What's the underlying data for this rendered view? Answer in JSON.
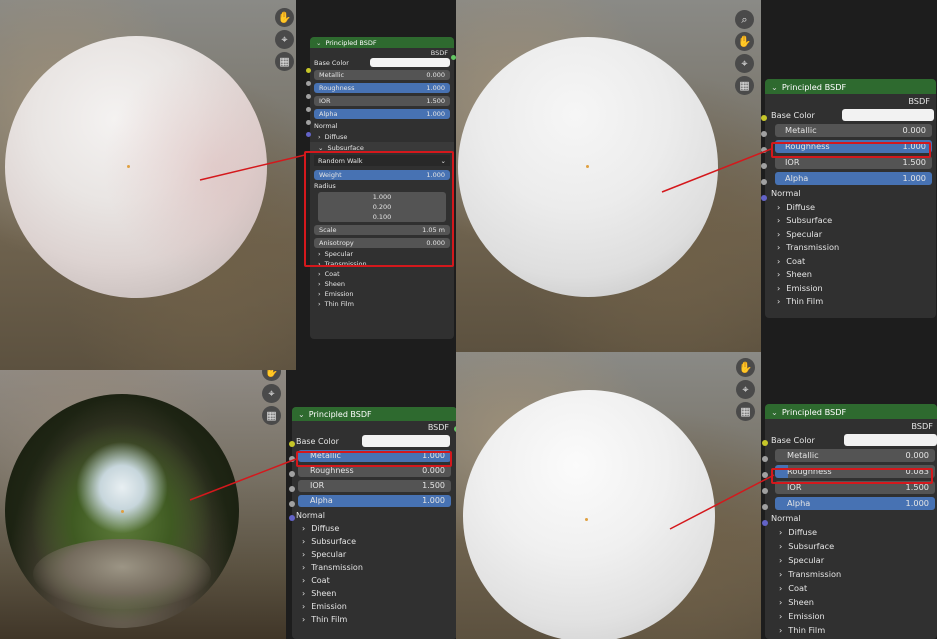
{
  "colors": {
    "header_green": "#2e6a2f",
    "field_grey": "#545454",
    "field_active_blue": "#4772b3",
    "panel_bg": "#303030",
    "highlight_red": "#d4181c",
    "socket_yellow": "#c7c729",
    "socket_grey": "#a1a1a1",
    "socket_purple": "#6363c7"
  },
  "icons": [
    "hand-icon",
    "camera-icon",
    "grid-icon",
    "zoom-icon"
  ],
  "q1": {
    "title": "Principled BSDF",
    "output": "BSDF",
    "base_color": "Base Color",
    "metallic": {
      "label": "Metallic",
      "value": "0.000"
    },
    "roughness": {
      "label": "Roughness",
      "value": "1.000"
    },
    "ior": {
      "label": "IOR",
      "value": "1.500"
    },
    "alpha": {
      "label": "Alpha",
      "value": "1.000"
    },
    "normal": "Normal",
    "diffuse": "Diffuse",
    "subsurface": "Subsurface",
    "method": "Random Walk",
    "weight": {
      "label": "Weight",
      "value": "1.000"
    },
    "radius": "Radius",
    "radius_values": [
      "1.000",
      "0.200",
      "0.100"
    ],
    "scale": {
      "label": "Scale",
      "value": "1.05 m"
    },
    "anisotropy": {
      "label": "Anisotropy",
      "value": "0.000"
    },
    "collapsed": [
      "Specular",
      "Transmission",
      "Coat",
      "Sheen",
      "Emission",
      "Thin Film"
    ]
  },
  "q2": {
    "title": "Principled BSDF",
    "output": "BSDF",
    "base_color": "Base Color",
    "metallic": {
      "label": "Metallic",
      "value": "0.000"
    },
    "roughness": {
      "label": "Roughness",
      "value": "1.000"
    },
    "ior": {
      "label": "IOR",
      "value": "1.500"
    },
    "alpha": {
      "label": "Alpha",
      "value": "1.000"
    },
    "normal": "Normal",
    "collapsed": [
      "Diffuse",
      "Subsurface",
      "Specular",
      "Transmission",
      "Coat",
      "Sheen",
      "Emission",
      "Thin Film"
    ]
  },
  "q3": {
    "title": "Principled BSDF",
    "output": "BSDF",
    "base_color": "Base Color",
    "metallic": {
      "label": "Metallic",
      "value": "1.000"
    },
    "roughness": {
      "label": "Roughness",
      "value": "0.000"
    },
    "ior": {
      "label": "IOR",
      "value": "1.500"
    },
    "alpha": {
      "label": "Alpha",
      "value": "1.000"
    },
    "normal": "Normal",
    "collapsed": [
      "Diffuse",
      "Subsurface",
      "Specular",
      "Transmission",
      "Coat",
      "Sheen",
      "Emission",
      "Thin Film"
    ]
  },
  "q4": {
    "title": "Principled BSDF",
    "output": "BSDF",
    "base_color": "Base Color",
    "metallic": {
      "label": "Metallic",
      "value": "0.000"
    },
    "roughness": {
      "label": "Roughness",
      "value": "0.083"
    },
    "ior": {
      "label": "IOR",
      "value": "1.500"
    },
    "alpha": {
      "label": "Alpha",
      "value": "1.000"
    },
    "normal": "Normal",
    "collapsed": [
      "Diffuse",
      "Subsurface",
      "Specular",
      "Transmission",
      "Coat",
      "Sheen",
      "Emission",
      "Thin Film"
    ]
  }
}
